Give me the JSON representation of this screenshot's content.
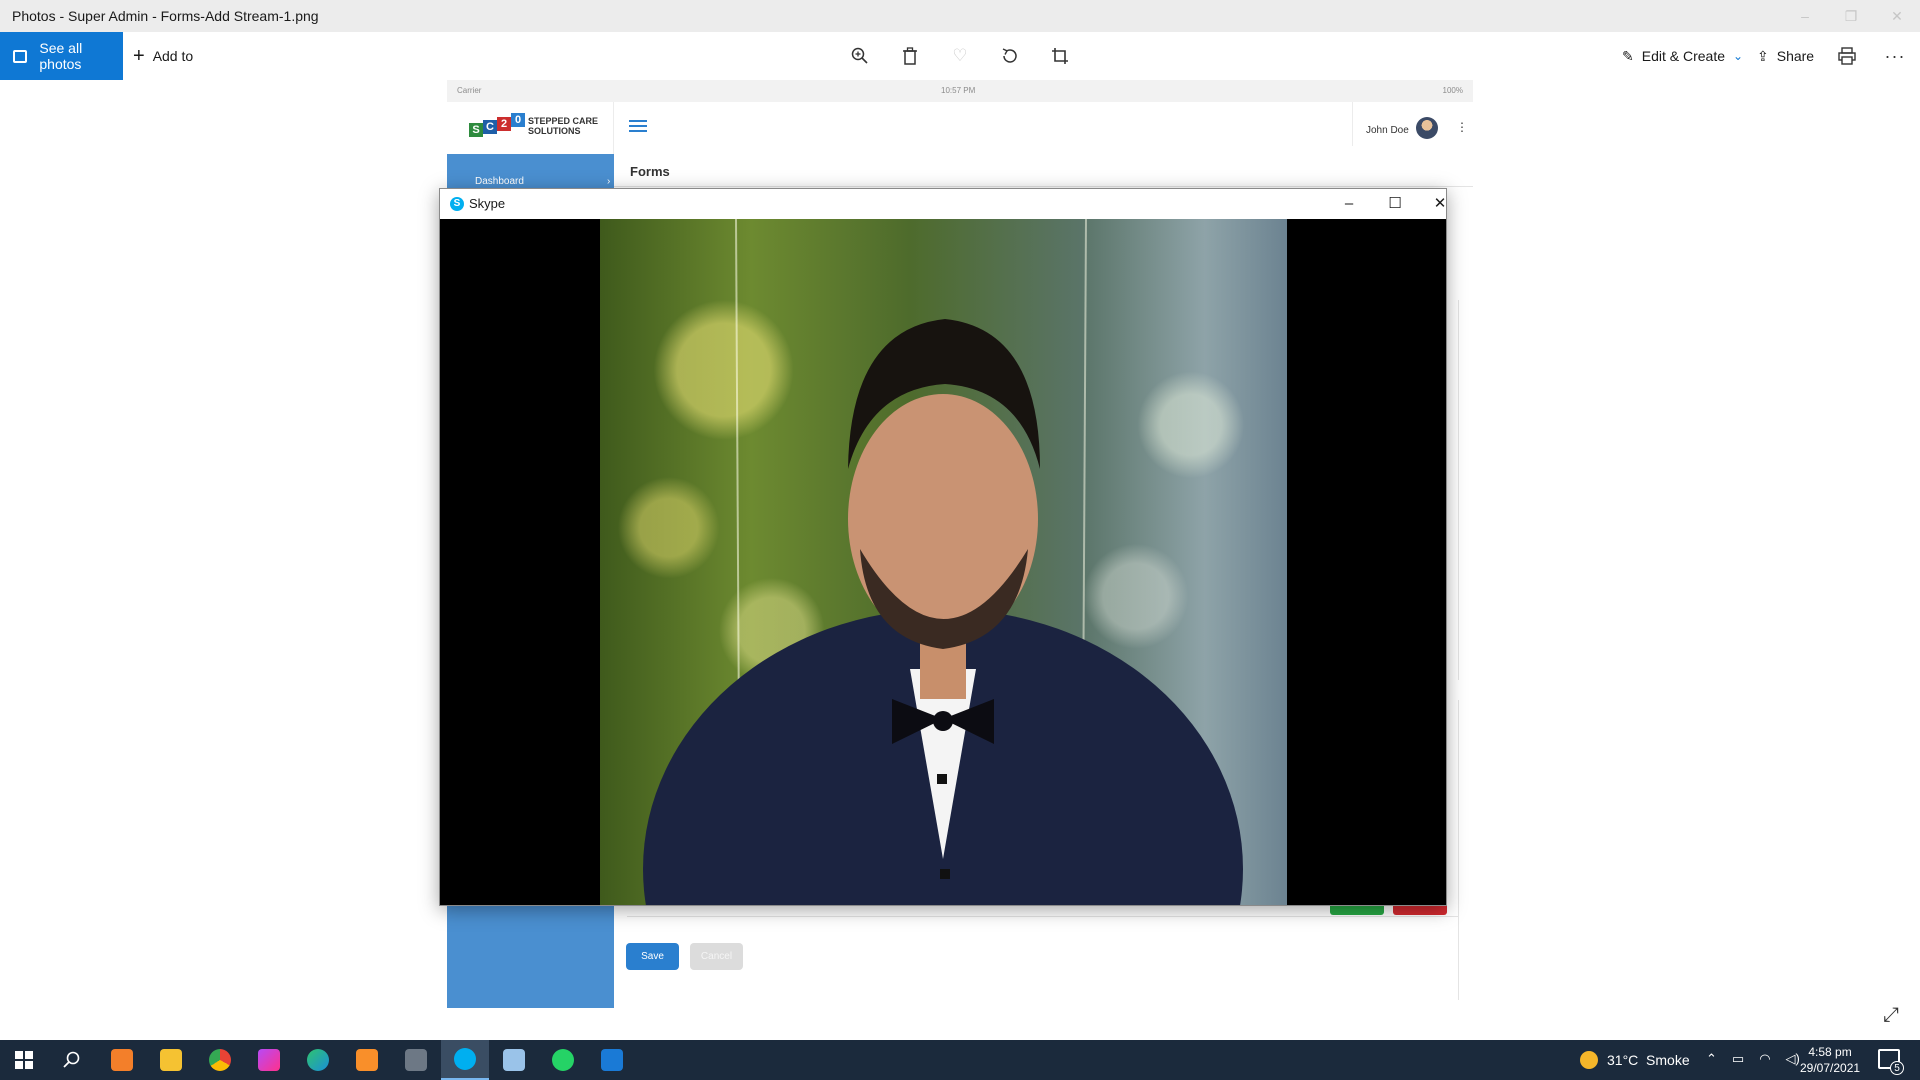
{
  "window": {
    "title": "Photos - Super Admin - Forms-Add Stream-1.png"
  },
  "toolbar": {
    "see_all_label": "See all photos",
    "add_to_label": "Add to",
    "edit_create_label": "Edit & Create",
    "share_label": "Share",
    "icons": [
      "zoom-icon",
      "delete-icon",
      "heart-icon",
      "rotate-icon",
      "crop-icon",
      "print-icon",
      "more-icon"
    ]
  },
  "photo_content": {
    "status_carrier": "Carrier",
    "status_time": "10:57 PM",
    "status_battery": "100%",
    "logo_letters": [
      "S",
      "C",
      "2",
      "0"
    ],
    "logo_text_line1": "STEPPED CARE",
    "logo_text_line2": "SOLUTIONS",
    "user_name": "John Doe",
    "sidebar_item": "Dashboard",
    "page_title": "Forms",
    "save_label": "Save",
    "cancel_label": "Cancel"
  },
  "skype": {
    "title": "Skype"
  },
  "taskbar": {
    "apps": [
      "windows-start",
      "search",
      "xampp",
      "file-explorer",
      "chrome",
      "phpstorm",
      "edge",
      "sublime-text",
      "calculator",
      "skype",
      "notepad",
      "whatsapp",
      "photos"
    ],
    "active_app": "skype",
    "weather": "31°C  Smoke",
    "time": "4:58 pm",
    "date": "29/07/2021",
    "notification_count": "5"
  },
  "colors": {
    "accent": "#0f78d4",
    "sidebar_blue": "#4a8fd0",
    "save_blue": "#2a7fcf",
    "taskbar": "#1b2a3c",
    "green": "#27a844",
    "red": "#d2292f"
  }
}
